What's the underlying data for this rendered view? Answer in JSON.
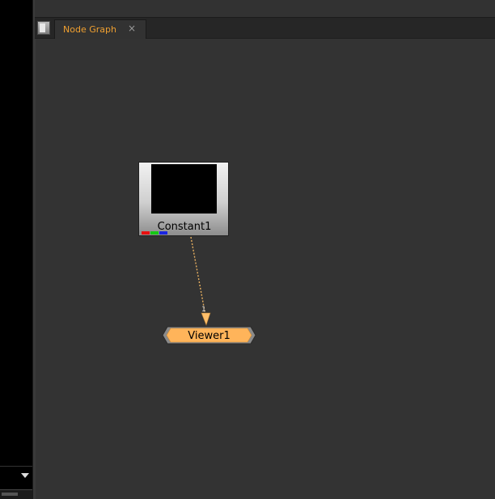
{
  "tabs": [
    {
      "label": "Node Graph",
      "close_glyph": "×",
      "active": true
    }
  ],
  "nodes": {
    "constant": {
      "label": "Constant1",
      "channels": [
        "#e81010",
        "#15c815",
        "#1a25e0"
      ]
    },
    "viewer": {
      "label": "Viewer1",
      "input_number": "1",
      "fill_color": "#ffb45a"
    }
  },
  "colors": {
    "tab_label": "#f0a030",
    "graph_background": "#333333",
    "connection": "#e8b060"
  },
  "icons": {
    "pane_menu": "pane-menu-icon",
    "tab_close": "close-icon",
    "dropdown": "chevron-down-icon"
  }
}
